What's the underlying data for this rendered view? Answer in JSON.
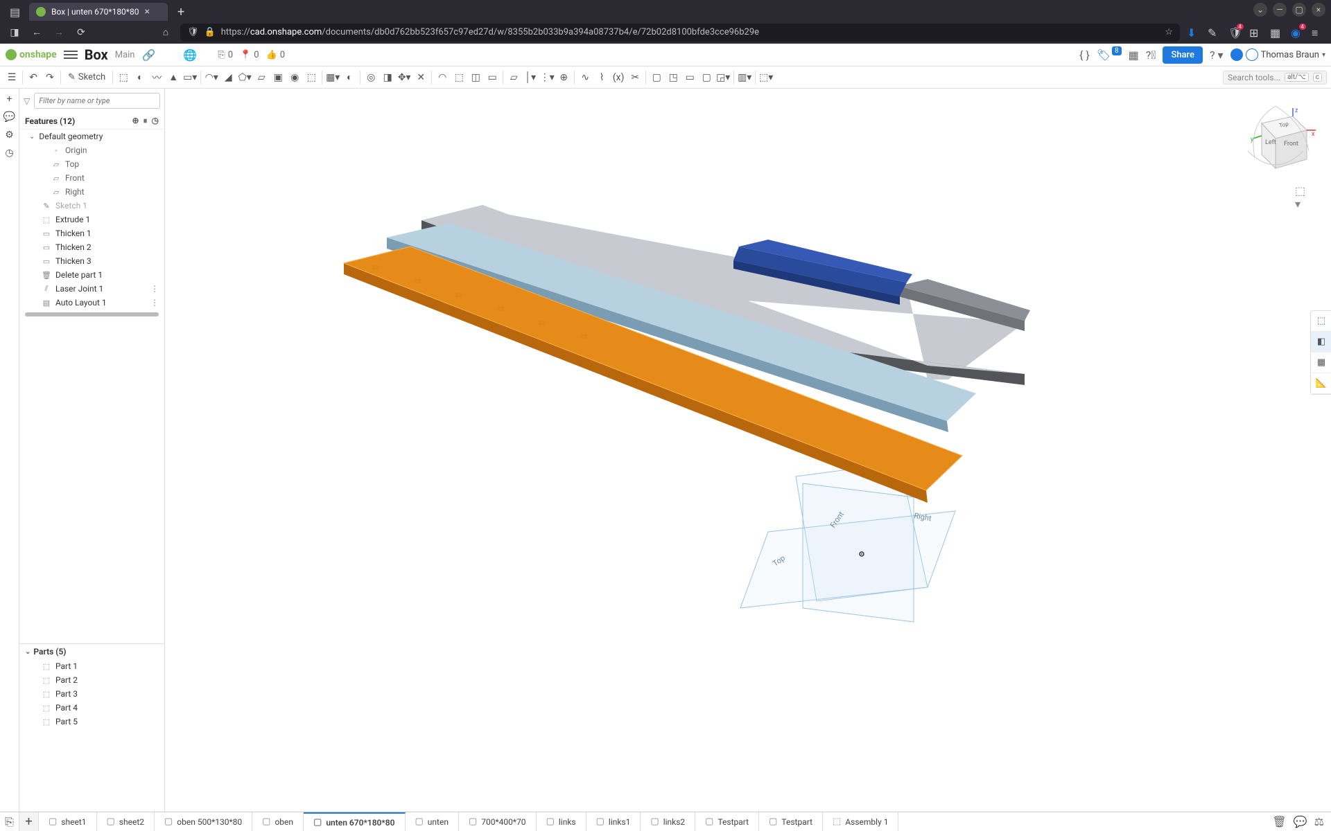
{
  "browser": {
    "tab_title": "Box | unten 670*180*80",
    "url_prefix": "https://",
    "url_domain": "cad.onshape.com",
    "url_path": "/documents/db0d762bb523f657c97ed27d/w/8355b2b033b9a394a08737b4/e/72b02d8100bfde3cce96b29e",
    "ublock_badge": "4",
    "ext_badge": "4"
  },
  "header": {
    "logo_text": "onshape",
    "doc_title": "Box",
    "branch": "Main",
    "stat_insert": "0",
    "stat_param": "0",
    "stat_like": "0",
    "notifications": "8",
    "share": "Share",
    "user_name": "Thomas Braun"
  },
  "toolbar": {
    "sketch": "Sketch",
    "search_placeholder": "Search tools...",
    "search_kbd1": "alt/⌥",
    "search_kbd2": "c"
  },
  "featurePanel": {
    "filter_placeholder": "Filter by name or type",
    "title": "Features (12)",
    "default_geometry": "Default geometry",
    "origin": "Origin",
    "top": "Top",
    "front": "Front",
    "right": "Right",
    "sketch1": "Sketch 1",
    "extrude1": "Extrude 1",
    "thicken1": "Thicken 1",
    "thicken2": "Thicken 2",
    "thicken3": "Thicken 3",
    "delete1": "Delete part 1",
    "laser1": "Laser Joint 1",
    "auto1": "Auto Layout 1",
    "parts_title": "Parts (5)",
    "parts": [
      "Part 1",
      "Part 2",
      "Part 3",
      "Part 4",
      "Part 5"
    ]
  },
  "viewCube": {
    "left": "Left",
    "front": "Front",
    "top": "Top",
    "x": "x",
    "y": "y",
    "z": "z"
  },
  "canvas": {
    "plane_front": "Front",
    "plane_right": "Right",
    "plane_top": "Top"
  },
  "bottomTabs": {
    "tabs": [
      {
        "label": "sheet1",
        "icon": "part"
      },
      {
        "label": "sheet2",
        "icon": "part"
      },
      {
        "label": "oben 500*130*80",
        "icon": "part"
      },
      {
        "label": "oben",
        "icon": "part"
      },
      {
        "label": "unten 670*180*80",
        "icon": "part",
        "active": true
      },
      {
        "label": "unten",
        "icon": "part"
      },
      {
        "label": "700*400*70",
        "icon": "part"
      },
      {
        "label": "links",
        "icon": "part"
      },
      {
        "label": "links1",
        "icon": "part"
      },
      {
        "label": "links2",
        "icon": "part"
      },
      {
        "label": "Testpart",
        "icon": "part"
      },
      {
        "label": "Testpart",
        "icon": "part"
      },
      {
        "label": "Assembly 1",
        "icon": "assembly"
      }
    ]
  }
}
